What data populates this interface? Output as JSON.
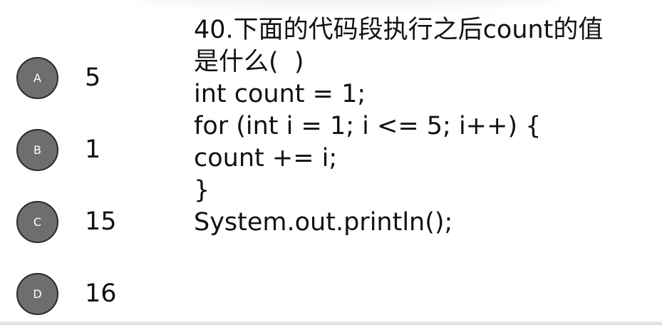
{
  "question": {
    "lines": [
      "40.下面的代码段执行之后count的值",
      "是什么(  )",
      "int count = 1;",
      "for (int i = 1; i <= 5; i++) {",
      "count += i;",
      "}",
      "System.out.println();"
    ]
  },
  "options": [
    {
      "letter": "A",
      "value": "5"
    },
    {
      "letter": "B",
      "value": "1"
    },
    {
      "letter": "C",
      "value": "15"
    },
    {
      "letter": "D",
      "value": "16"
    }
  ],
  "colors": {
    "option_circle": "#6e6e6e",
    "option_circle_border": "#2a2a2a",
    "text": "#111111",
    "background": "#ffffff"
  }
}
